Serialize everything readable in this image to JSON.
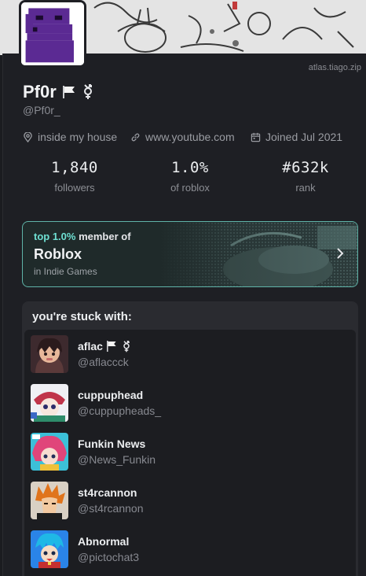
{
  "watermark": "atlas.tiago.zip",
  "profile": {
    "name": "Pf0r",
    "handle": "@Pf0r_",
    "location": "inside my house",
    "website": "www.youtube.com",
    "joined": "Joined Jul 2021"
  },
  "stats": [
    {
      "value": "1,840",
      "label": "followers"
    },
    {
      "value": "1.0%",
      "label": "of roblox"
    },
    {
      "value": "#632k",
      "label": "rank"
    }
  ],
  "rank_card": {
    "highlight": "top 1.0%",
    "rest": " member of",
    "game": "Roblox",
    "category": "in Indie Games",
    "accent": "#5fb3a8"
  },
  "stuck_with": {
    "title": "you're stuck with:",
    "friends": [
      {
        "name": "aflac",
        "handle": "@aflaccck"
      },
      {
        "name": "cuppuphead",
        "handle": "@cuppupheads_"
      },
      {
        "name": "Funkin News",
        "handle": "@News_Funkin"
      },
      {
        "name": "st4rcannon",
        "handle": "@st4rcannon"
      },
      {
        "name": "Abnormal",
        "handle": "@pictochat3"
      }
    ]
  }
}
